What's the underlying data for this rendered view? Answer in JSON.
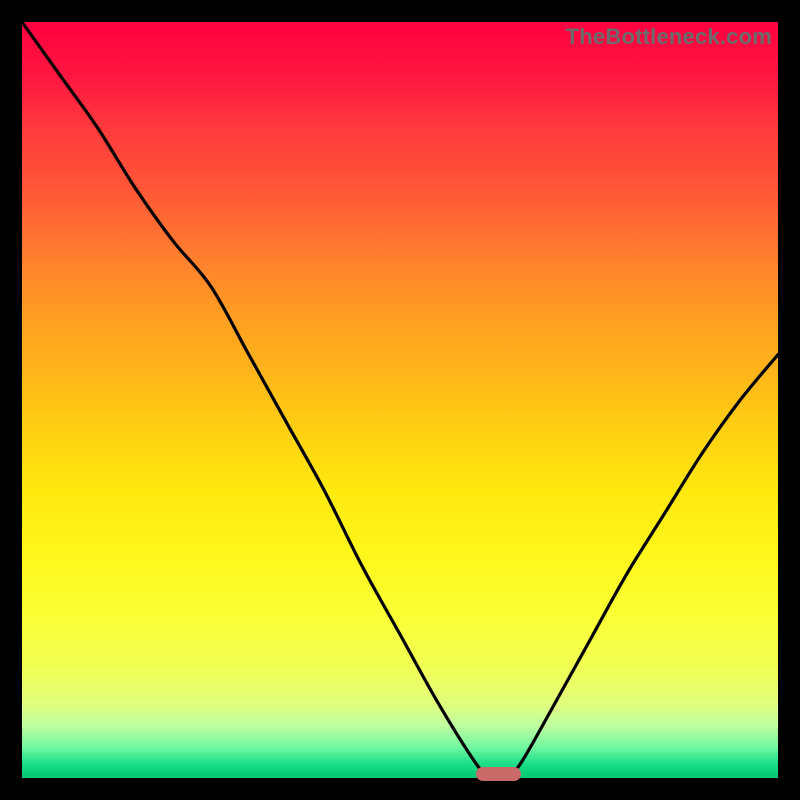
{
  "watermark": "TheBottleneck.com",
  "colors": {
    "frame": "#000000",
    "curve": "#000000",
    "marker": "#c96a69"
  },
  "chart_data": {
    "type": "line",
    "title": "",
    "xlabel": "",
    "ylabel": "",
    "xlim": [
      0,
      100
    ],
    "ylim": [
      0,
      100
    ],
    "x": [
      0,
      5,
      10,
      15,
      20,
      25,
      30,
      35,
      40,
      45,
      50,
      55,
      60,
      62,
      64,
      66,
      70,
      75,
      80,
      85,
      90,
      95,
      100
    ],
    "values": [
      100,
      93,
      86,
      78,
      71,
      65,
      56,
      47,
      38,
      28,
      19,
      10,
      2,
      0,
      0,
      2,
      9,
      18,
      27,
      35,
      43,
      50,
      56
    ],
    "marker": {
      "x_center": 63,
      "y": 0,
      "width_pct": 6
    },
    "note": "x-axis and y-axis have no visible tick labels; values are read as percentages of the plot area. Curve is a V shape with minimum at roughly x=63%."
  }
}
